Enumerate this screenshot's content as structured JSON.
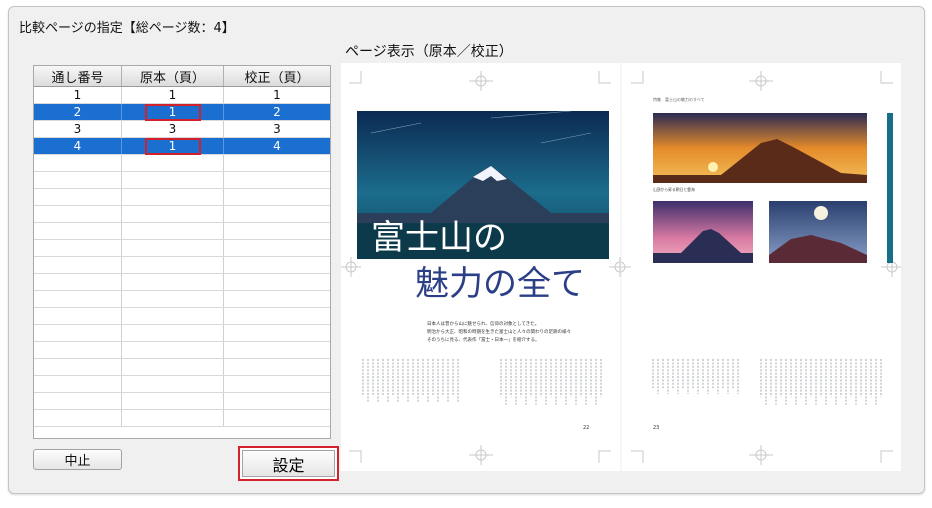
{
  "dialog": {
    "title": "比較ページの指定【総ページ数：4】",
    "preview_label": "ページ表示（原本／校正）"
  },
  "table": {
    "headers": [
      "通し番号",
      "原本（頁）",
      "校正（頁）"
    ],
    "rows": [
      {
        "serial": "1",
        "original": "1",
        "proof": "1",
        "selected": false
      },
      {
        "serial": "2",
        "original": "1",
        "proof": "2",
        "selected": true
      },
      {
        "serial": "3",
        "original": "3",
        "proof": "3",
        "selected": false
      },
      {
        "serial": "4",
        "original": "1",
        "proof": "4",
        "selected": true
      }
    ],
    "empty_rows": 16
  },
  "buttons": {
    "stop": "中止",
    "set": "設定"
  },
  "preview": {
    "headline_line1": "富士山の",
    "headline_line2": "魅力の全て",
    "page_left_number": "22",
    "page_right_number": "23",
    "caption_right_top": "山頂から昇る朝日と雲海",
    "header_right": "特集　富士山の魅力のすべて",
    "lead_text": [
      "日本人は昔から山に魅せられ、信仰の対象としてきた。",
      "明治から大正、昭和の時期を生きた富士山と人々の関わりの足跡の様々",
      "そのうちに見る、代表作「冨士・日本一」を紹介する。"
    ]
  },
  "colors": {
    "selection": "#1b6fd0",
    "highlight": "#d3212b"
  }
}
